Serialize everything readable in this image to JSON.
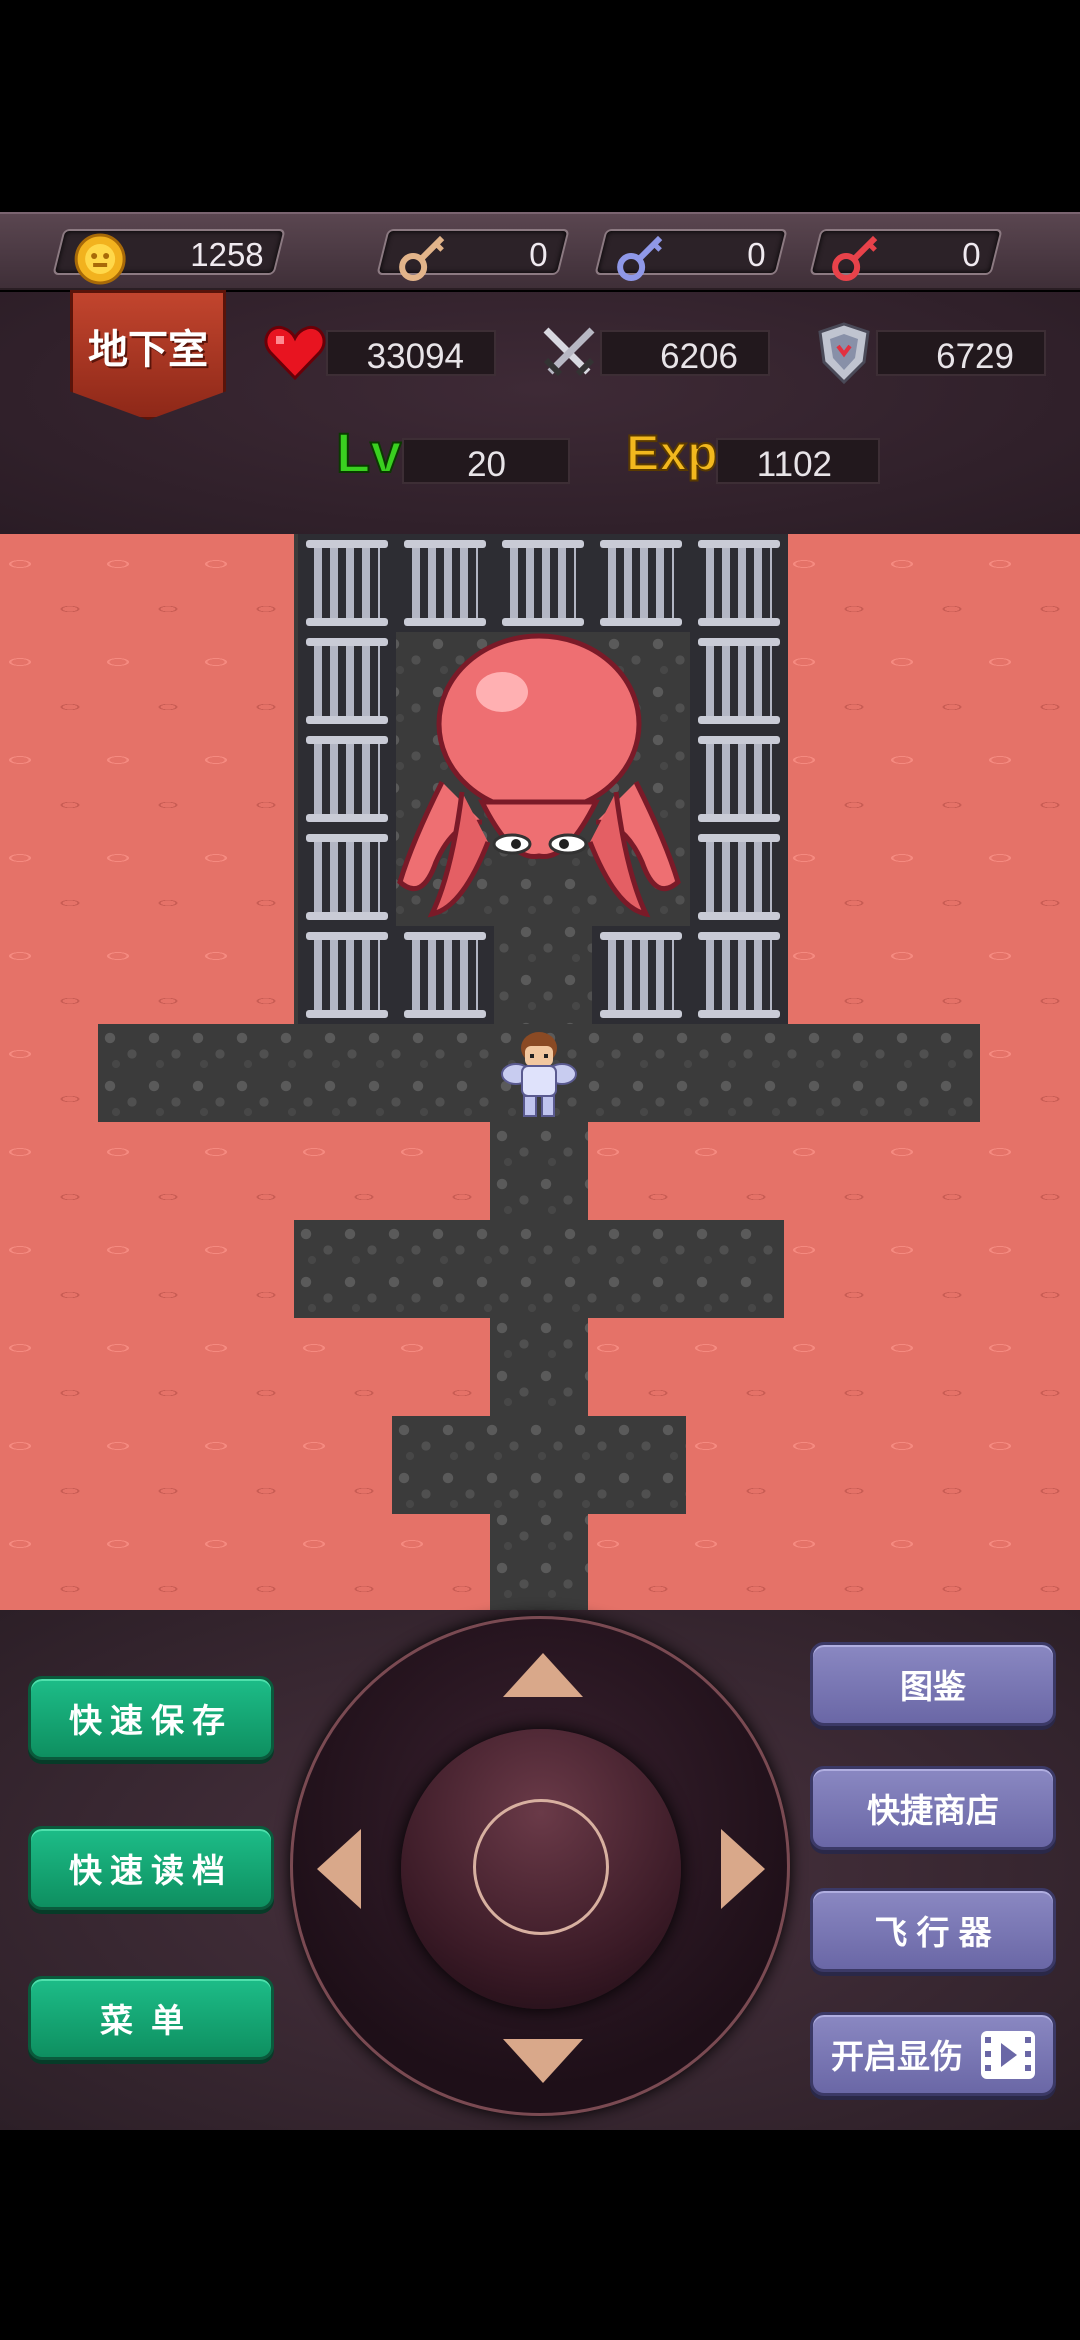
{
  "resources": {
    "gold": "1258",
    "yellow_keys": "0",
    "blue_keys": "0",
    "red_keys": "0"
  },
  "floor_name": "地下室",
  "stats": {
    "hp": "33094",
    "attack": "6206",
    "defense": "6729",
    "level_label": "Lv",
    "level": "20",
    "exp_label": "Exp",
    "exp": "1102"
  },
  "buttons_left": {
    "quick_save": "快速保存",
    "quick_load": "快速读档",
    "menu": "菜单"
  },
  "buttons_right": {
    "monster_book": "图鉴",
    "quick_shop": "快捷商店",
    "flyer": "飞 行 器",
    "damage_display": "开启显伤"
  },
  "colors": {
    "lava": "#e57268",
    "floor": "#3b3b3b",
    "green_button": "#1dbd88",
    "purple_button": "#7a78b4"
  }
}
